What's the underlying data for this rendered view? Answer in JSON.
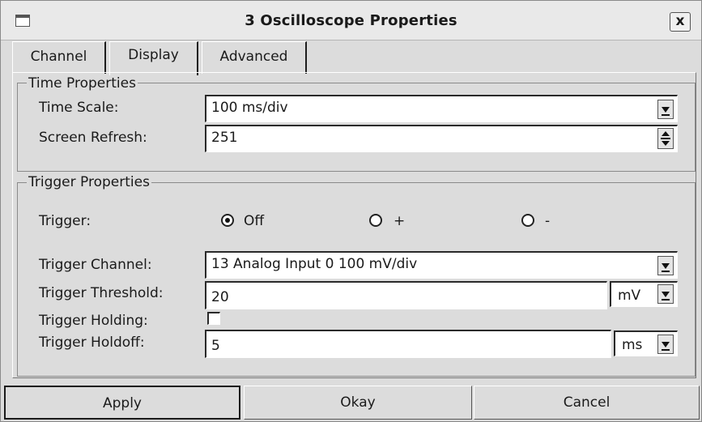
{
  "window": {
    "title": "3 Oscilloscope Properties",
    "close_label": "x"
  },
  "tabs": [
    {
      "label": "Channel"
    },
    {
      "label": "Display"
    },
    {
      "label": "Advanced"
    }
  ],
  "active_tab": "Display",
  "time_properties": {
    "title": "Time Properties",
    "time_scale_label": "Time Scale:",
    "time_scale_value": "100 ms/div",
    "screen_refresh_label": "Screen Refresh:",
    "screen_refresh_value": "251"
  },
  "trigger_properties": {
    "title": "Trigger Properties",
    "trigger_label": "Trigger:",
    "trigger_options": [
      {
        "label": "Off",
        "selected": true
      },
      {
        "label": "+",
        "selected": false
      },
      {
        "label": "-",
        "selected": false
      }
    ],
    "trigger_channel_label": "Trigger Channel:",
    "trigger_channel_value": "13 Analog Input 0 100 mV/div",
    "trigger_threshold_label": "Trigger Threshold:",
    "trigger_threshold_value": "20",
    "trigger_threshold_unit": "mV",
    "trigger_holding_label": "Trigger Holding:",
    "trigger_holding_checked": false,
    "trigger_holdoff_label": "Trigger Holdoff:",
    "trigger_holdoff_value": "5",
    "trigger_holdoff_unit": "ms"
  },
  "buttons": {
    "apply": "Apply",
    "okay": "Okay",
    "cancel": "Cancel"
  }
}
